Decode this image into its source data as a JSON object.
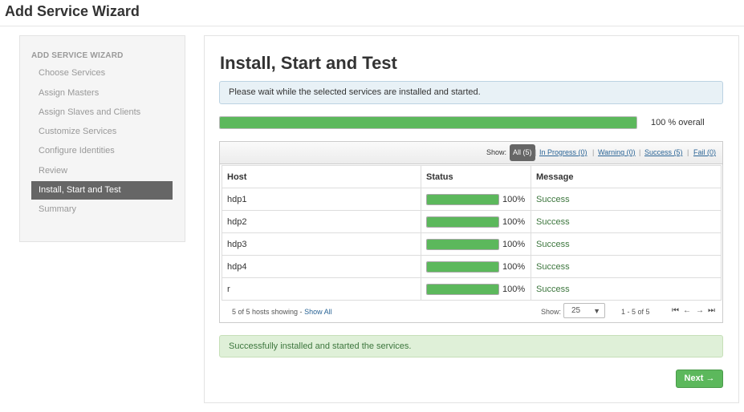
{
  "app": {
    "title": "Add Service Wizard"
  },
  "sidebar": {
    "header": "ADD SERVICE WIZARD",
    "items": [
      {
        "label": "Choose Services"
      },
      {
        "label": "Assign Masters"
      },
      {
        "label": "Assign Slaves and Clients"
      },
      {
        "label": "Customize Services"
      },
      {
        "label": "Configure Identities"
      },
      {
        "label": "Review"
      },
      {
        "label": "Install, Start and Test",
        "active": true
      },
      {
        "label": "Summary"
      }
    ]
  },
  "main": {
    "title": "Install, Start and Test",
    "info_message": "Please wait while the selected services are installed and started.",
    "overall_progress": 100,
    "overall_text": "100 % overall",
    "filters": {
      "show_label": "Show:",
      "all": "All (5)",
      "in_progress": "In Progress (0)",
      "warning": "Warning (0)",
      "success": "Success (5)",
      "fail": "Fail (0)",
      "separator": "|"
    },
    "table": {
      "headers": [
        "Host",
        "Status",
        "Message"
      ],
      "rows": [
        {
          "host": "hdp1",
          "progress": 100,
          "percent": "100%",
          "message": "Success"
        },
        {
          "host": "hdp2",
          "progress": 100,
          "percent": "100%",
          "message": "Success"
        },
        {
          "host": "hdp3",
          "progress": 100,
          "percent": "100%",
          "message": "Success"
        },
        {
          "host": "hdp4",
          "progress": 100,
          "percent": "100%",
          "message": "Success"
        },
        {
          "host": "r",
          "progress": 100,
          "percent": "100%",
          "message": "Success"
        }
      ]
    },
    "footer": {
      "hosts_showing": "5 of 5 hosts showing - ",
      "show_all": "Show All",
      "show_label": "Show:",
      "page_size": "25",
      "range": "1 - 5 of 5"
    },
    "success_message": "Successfully installed and started the services.",
    "next_label": "Next →"
  },
  "colors": {
    "progress": "#5cb85c",
    "active_nav": "#666666",
    "link": "#2a6496"
  }
}
